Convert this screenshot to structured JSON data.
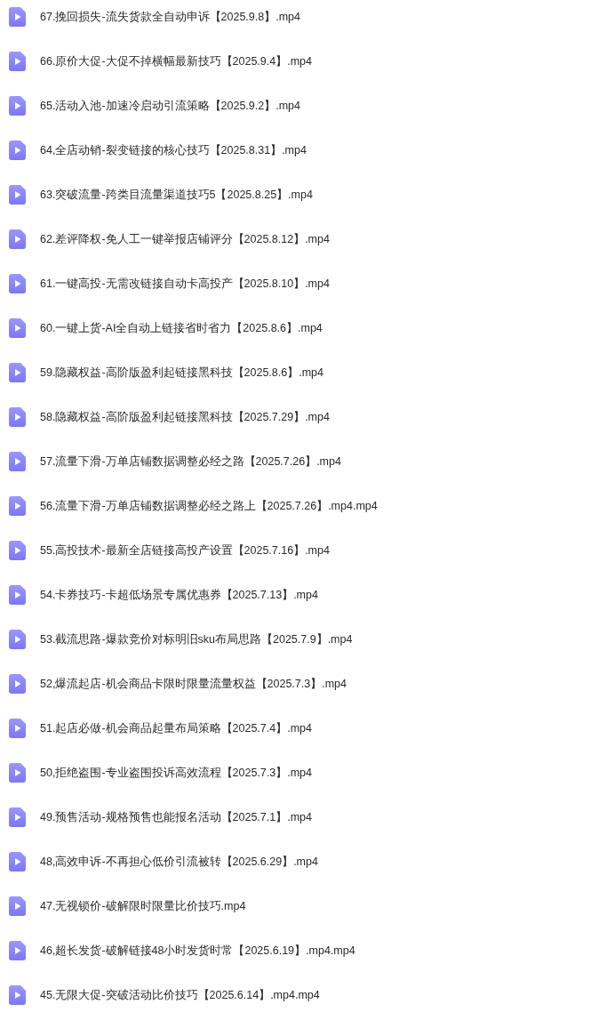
{
  "files": [
    {
      "name": "67.挽回损失-流失货款全自动申诉【2025.9.8】.mp4"
    },
    {
      "name": "66.原价大促-大促不掉横幅最新技巧【2025.9.4】.mp4"
    },
    {
      "name": "65.活动入池-加速冷启动引流策略【2025.9.2】.mp4"
    },
    {
      "name": "64,全店动销-裂变链接的核心技巧【2025.8.31】.mp4"
    },
    {
      "name": "63.突破流量-跨类目流量渠道技巧5【2025.8.25】.mp4"
    },
    {
      "name": "62.差评降权-免人工一键举报店铺评分【2025.8.12】.mp4"
    },
    {
      "name": "61.一键高投-无需改链接自动卡高投产【2025.8.10】.mp4"
    },
    {
      "name": "60.一键上货-AI全自动上链接省时省力【2025.8.6】.mp4"
    },
    {
      "name": "59.隐藏权益-高阶版盈利起链接黑科技【2025.8.6】.mp4"
    },
    {
      "name": "58.隐藏权益-高阶版盈利起链接黑科技【2025.7.29】.mp4"
    },
    {
      "name": "57.流量下滑-万单店铺数据调整必经之路【2025.7.26】.mp4"
    },
    {
      "name": "56.流量下滑-万单店铺数据调整必经之路上【2025.7.26】.mp4.mp4"
    },
    {
      "name": "55.高投技术-最新全店链接高投产设置【2025.7.16】.mp4"
    },
    {
      "name": "54.卡券技巧-卡超低场景专属优惠券【2025.7.13】.mp4"
    },
    {
      "name": "53.截流思路-爆款竞价对标明旧sku布局思路【2025.7.9】.mp4"
    },
    {
      "name": "52,爆流起店-机会商品卡限时限量流量权益【2025.7.3】.mp4"
    },
    {
      "name": "51.起店必做-机会商品起量布局策略【2025.7.4】.mp4"
    },
    {
      "name": "50,拒绝盗围-专业盗围投诉高效流程【2025.7.3】.mp4"
    },
    {
      "name": "49.预售活动-规格预售也能报名活动【2025.7.1】.mp4"
    },
    {
      "name": "48,高效申诉-不再担心低价引流被转【2025.6.29】.mp4"
    },
    {
      "name": "47.无视锁价-破解限时限量比价技巧.mp4"
    },
    {
      "name": "46,超长发货-破解链接48小时发货时常【2025.6.19】.mp4.mp4"
    },
    {
      "name": "45.无限大促-突破活动比价技巧【2025.6.14】.mp4.mp4"
    }
  ]
}
